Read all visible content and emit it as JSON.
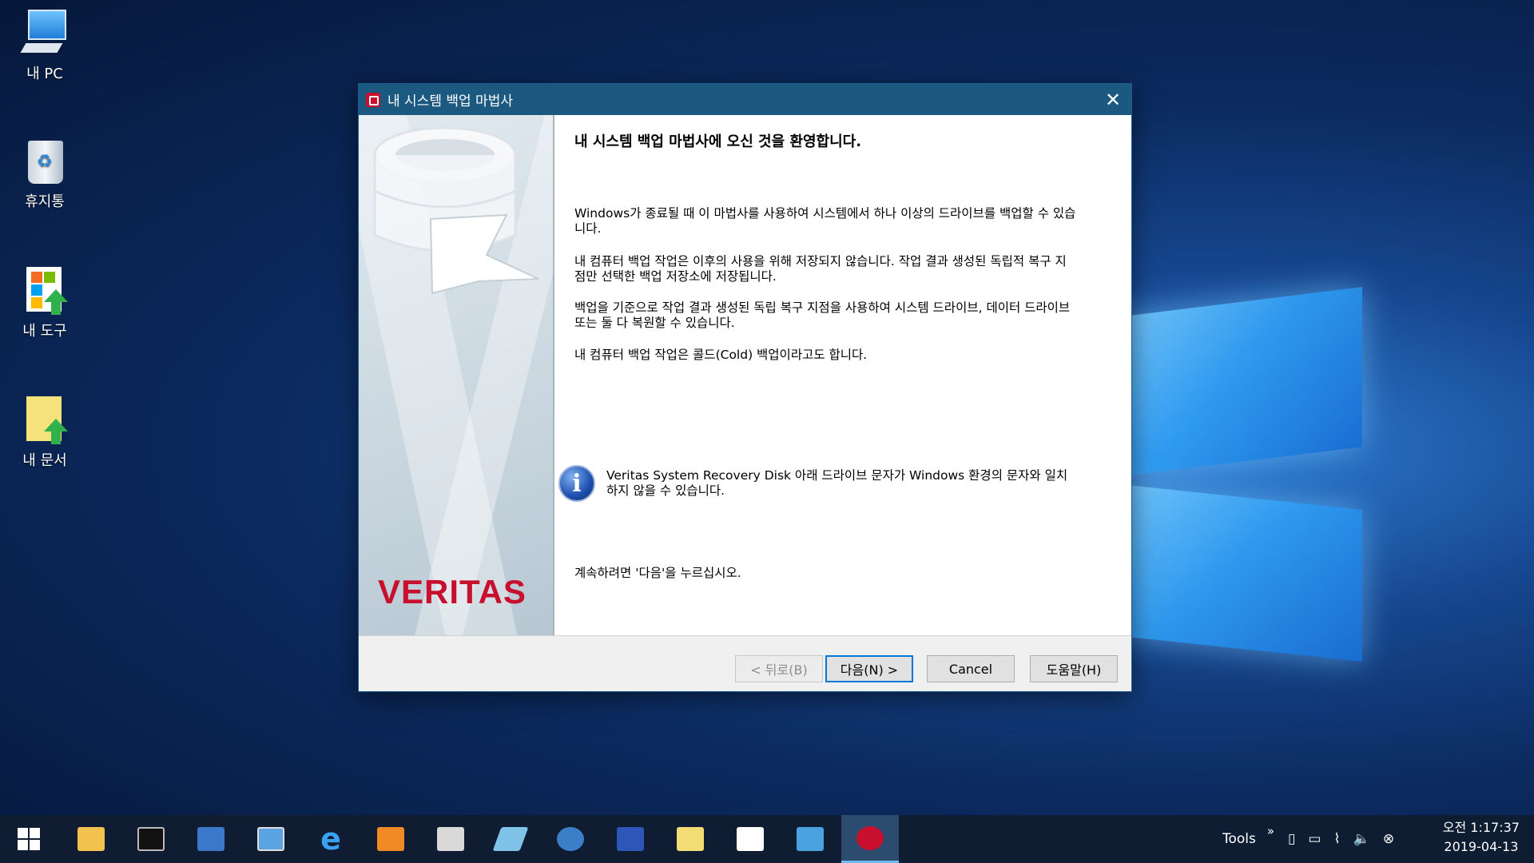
{
  "desktop": {
    "icons": [
      {
        "label": "내 PC",
        "icon": "computer-icon"
      },
      {
        "label": "휴지통",
        "icon": "recycle-bin-icon"
      },
      {
        "label": "내 도구",
        "icon": "tools-folder-icon"
      },
      {
        "label": "내 문서",
        "icon": "documents-folder-icon"
      }
    ]
  },
  "dialog": {
    "title": "내 시스템 백업 마법사",
    "heading": "내 시스템 백업 마법사에 오신 것을 환영합니다.",
    "paragraphs": [
      "Windows가 종료될 때 이 마법사를 사용하여 시스템에서 하나 이상의 드라이브를 백업할 수 있습니다.",
      "내 컴퓨터 백업 작업은 이후의 사용을 위해 저장되지 않습니다. 작업 결과 생성된 독립적 복구 지점만 선택한 백업 저장소에 저장됩니다.",
      "백업을 기준으로 작업 결과 생성된 독립 복구 지점을 사용하여 시스템 드라이브, 데이터 드라이브 또는 둘 다 복원할 수 있습니다.",
      "내 컴퓨터 백업 작업은 콜드(Cold) 백업이라고도 합니다."
    ],
    "info_note": "Veritas System Recovery Disk 아래 드라이브 문자가 Windows 환경의 문자와 일치하지 않을 수 있습니다.",
    "continue_text": "계속하려면 '다음'을 누르십시오.",
    "brand": "VERITAS",
    "buttons": {
      "back": "< 뒤로(B)",
      "next": "다음(N) >",
      "cancel": "Cancel",
      "help": "도움말(H)"
    },
    "brand_color": "#c8102e"
  },
  "taskbar": {
    "tools_label": "Tools",
    "overflow": "»",
    "clock": {
      "time": "오전 1:17:37",
      "date": "2019-04-13"
    },
    "apps": [
      "start-icon",
      "file-explorer-icon",
      "command-prompt-icon",
      "remote-desktop-icon",
      "monitor-icon",
      "internet-explorer-icon",
      "media-player-icon",
      "scanner-icon",
      "eraser-icon",
      "search-tool-icon",
      "save-disk-icon",
      "documents-icon",
      "tools-icon",
      "network-icon",
      "veritas-app-icon"
    ]
  }
}
